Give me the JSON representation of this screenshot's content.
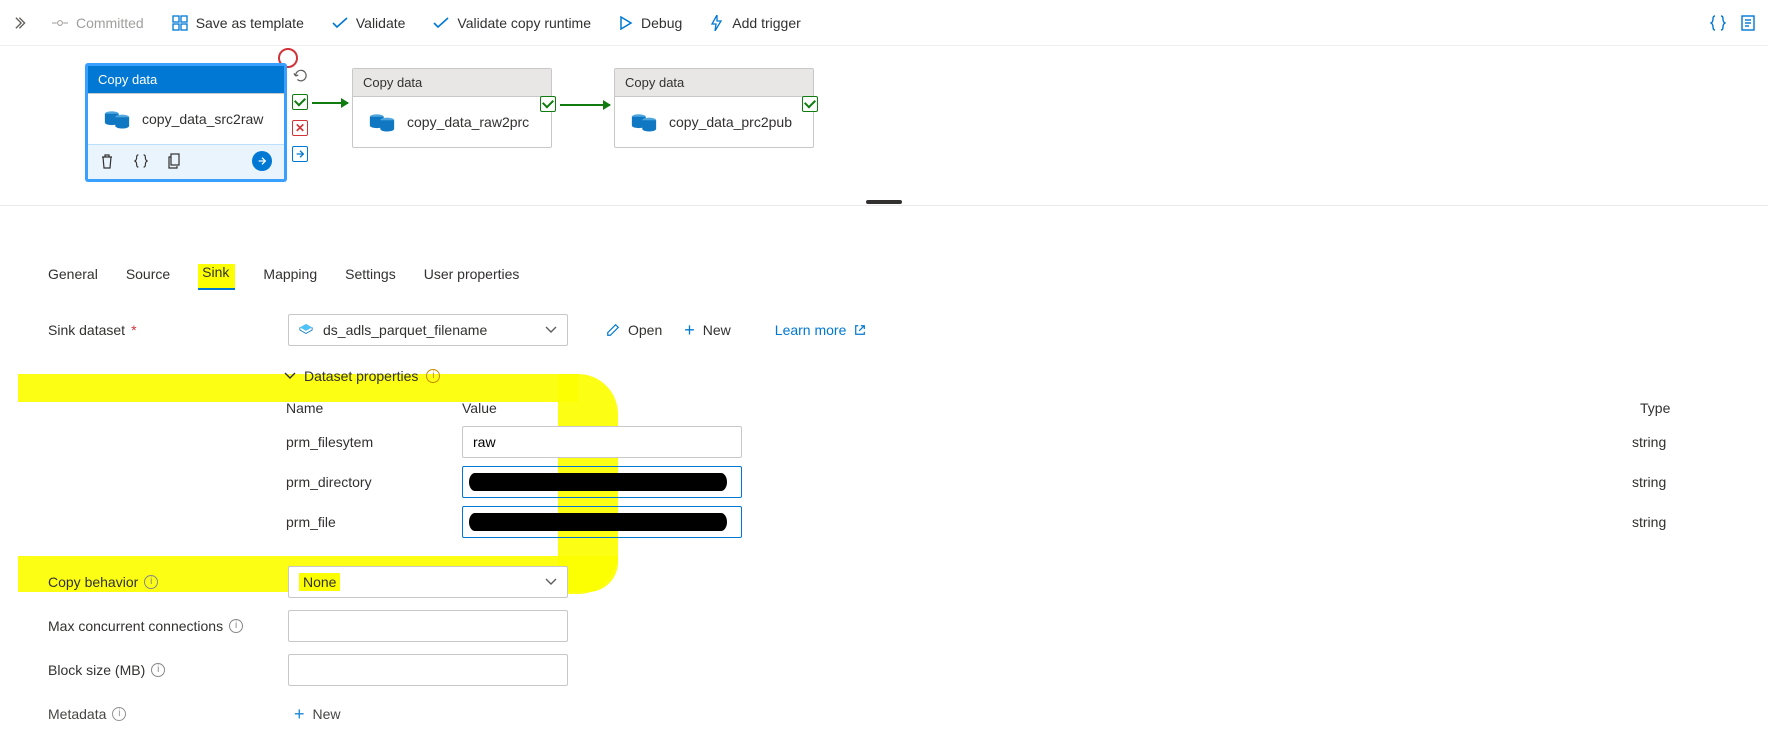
{
  "toolbar": {
    "committed": "Committed",
    "save_template": "Save as template",
    "validate": "Validate",
    "validate_copy_rt": "Validate copy runtime",
    "debug": "Debug",
    "add_trigger": "Add trigger"
  },
  "nodes": {
    "copy_data_label": "Copy data",
    "a_name": "copy_data_src2raw",
    "b_name": "copy_data_raw2prc",
    "c_name": "copy_data_prc2pub"
  },
  "tabs": {
    "general": "General",
    "source": "Source",
    "sink": "Sink",
    "mapping": "Mapping",
    "settings": "Settings",
    "user_props": "User properties"
  },
  "form": {
    "sink_dataset_lbl": "Sink dataset",
    "sink_dataset_val": "ds_adls_parquet_filename",
    "open": "Open",
    "new": "New",
    "learn_more": "Learn more",
    "dataset_props": "Dataset properties",
    "col_name": "Name",
    "col_value": "Value",
    "col_type": "Type",
    "rows": [
      {
        "name": "prm_filesytem",
        "value": "raw",
        "type": "string",
        "blue": false,
        "redacted": false
      },
      {
        "name": "prm_directory",
        "value": "",
        "type": "string",
        "blue": true,
        "redacted": true
      },
      {
        "name": "prm_file",
        "value": "",
        "type": "string",
        "blue": true,
        "redacted": true
      }
    ],
    "copy_behavior_lbl": "Copy behavior",
    "copy_behavior_val": "None",
    "max_conn_lbl": "Max concurrent connections",
    "block_size_lbl": "Block size (MB)",
    "metadata_lbl": "Metadata",
    "metadata_new": "New"
  }
}
